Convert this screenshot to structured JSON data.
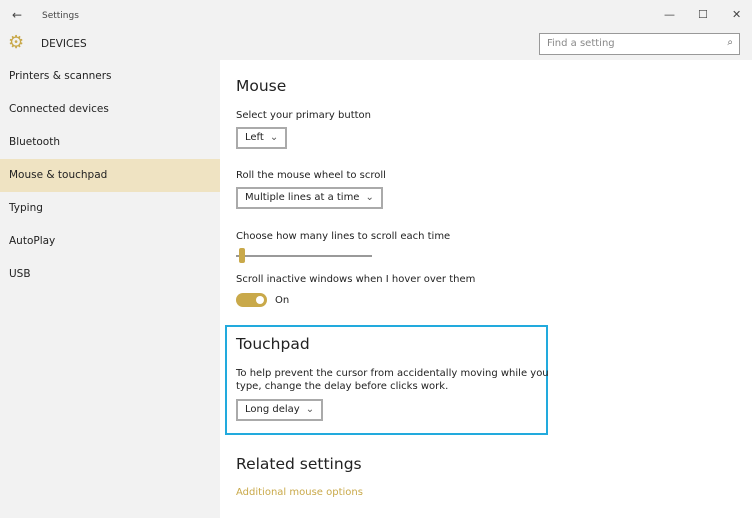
{
  "window": {
    "title": "Settings",
    "back_icon": "arrow-left-icon",
    "minimize": "—",
    "maximize": "☐",
    "close": "✕"
  },
  "header": {
    "icon": "gear-icon",
    "title": "DEVICES",
    "search_placeholder": "Find a setting"
  },
  "sidebar": {
    "items": [
      {
        "label": "Printers & scanners"
      },
      {
        "label": "Connected devices"
      },
      {
        "label": "Bluetooth"
      },
      {
        "label": "Mouse & touchpad",
        "selected": true
      },
      {
        "label": "Typing"
      },
      {
        "label": "AutoPlay"
      },
      {
        "label": "USB"
      }
    ]
  },
  "mouse": {
    "heading": "Mouse",
    "primary_label": "Select your primary button",
    "primary_value": "Left",
    "wheel_label": "Roll the mouse wheel to scroll",
    "wheel_value": "Multiple lines at a time",
    "lines_label": "Choose how many lines to scroll each time",
    "lines_slider_fraction": 0,
    "inactive_label": "Scroll inactive windows when I hover over them",
    "inactive_state": "On"
  },
  "touchpad": {
    "heading": "Touchpad",
    "desc1": "To help prevent the cursor from accidentally moving while you",
    "desc2": "type, change the delay before clicks work.",
    "delay_value": "Long delay"
  },
  "related": {
    "heading": "Related settings",
    "link": "Additional mouse options"
  },
  "colors": {
    "accent": "#c9a94a",
    "highlight": "#22aadd",
    "selected_bg": "#efe3c2"
  }
}
